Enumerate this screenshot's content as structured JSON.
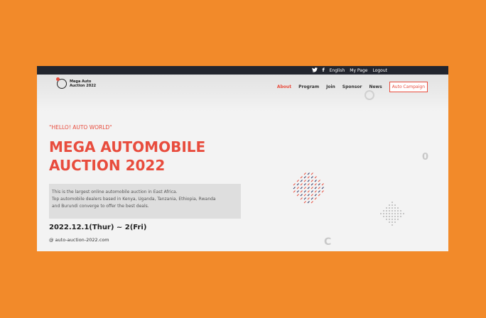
{
  "topbar": {
    "twitter_icon": "twitter-icon",
    "facebook_icon": "facebook-icon",
    "links": [
      "English",
      "My Page",
      "Logout"
    ]
  },
  "logo": {
    "line1": "Mega Auto",
    "line2": "Auction 2022"
  },
  "nav": {
    "items": [
      "About",
      "Program",
      "Join",
      "Sponsor",
      "News"
    ],
    "cta": "Auto Campaign"
  },
  "hero": {
    "tagline": "\"HELLO! AUTO WORLD\"",
    "title_line1": "MEGA AUTOMOBILE",
    "title_line2": "AUCTION 2022",
    "description_line1": "This is the largest online automobile auction in East Africa.",
    "description_line2": "Top automobile dealers based in Kenya, Uganda, Tanzania, Ethiopia, Rwanda",
    "description_line3": "and Burundi converge to offer the best deals.",
    "date": "2022.12.1(Thur) ~ 2(Fri)",
    "url": "@ auto-auction-2022.com"
  },
  "colors": {
    "accent": "#e84c3d",
    "topbar": "#22252e",
    "background": "#f28a2a"
  }
}
